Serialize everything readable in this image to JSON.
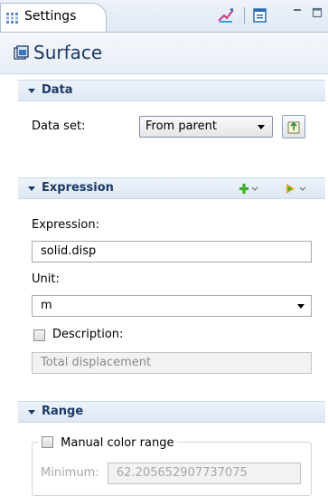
{
  "tab": {
    "label": "Settings"
  },
  "panel": {
    "title": "Surface"
  },
  "sections": {
    "data": {
      "header": "Data",
      "dataset_label": "Data set:",
      "dataset_value": "From parent"
    },
    "expression": {
      "header": "Expression",
      "expression_label": "Expression:",
      "expression_value": "solid.disp",
      "unit_label": "Unit:",
      "unit_value": "m",
      "description_label": "Description:",
      "description_value": "Total displacement"
    },
    "range": {
      "header": "Range",
      "manual_color_label": "Manual color range",
      "minimum_label": "Minimum:",
      "minimum_value": "62.205652907737075"
    }
  },
  "colors": {
    "header_text": "#1b3a66",
    "header_bg": "#e4ecf6",
    "add_icon": "#3fae29",
    "arrow_icon": "#e0a526"
  }
}
